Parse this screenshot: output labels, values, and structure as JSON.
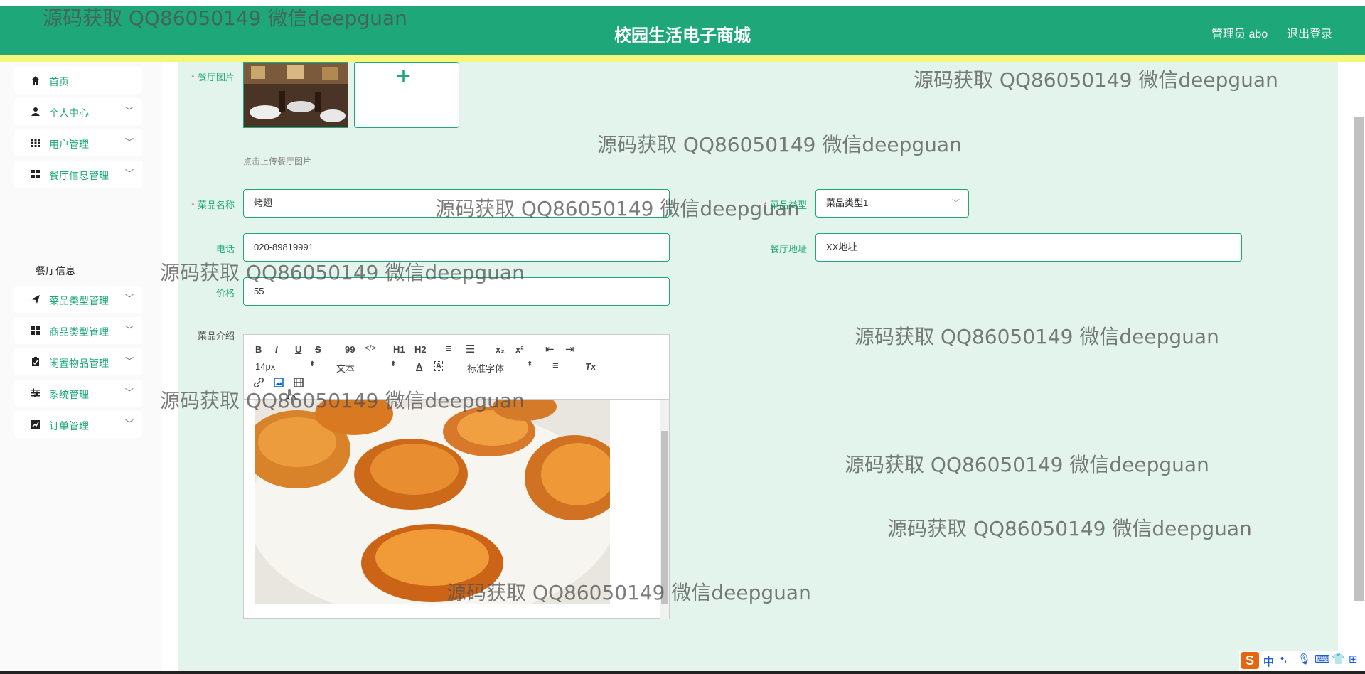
{
  "header": {
    "title": "校园生活电子商城",
    "user": "管理员 abo",
    "logout": "退出登录"
  },
  "sidebar": {
    "items": [
      {
        "label": "首页",
        "icon": "home-icon"
      },
      {
        "label": "个人中心",
        "icon": "user-icon"
      },
      {
        "label": "用户管理",
        "icon": "grid-icon"
      },
      {
        "label": "餐厅信息管理",
        "icon": "apps-icon"
      },
      {
        "label": "菜品类型管理",
        "icon": "send-icon"
      },
      {
        "label": "商品类型管理",
        "icon": "apps-icon"
      },
      {
        "label": "闲置物品管理",
        "icon": "clipboard-icon"
      },
      {
        "label": "系统管理",
        "icon": "sliders-icon"
      },
      {
        "label": "订单管理",
        "icon": "chart-icon"
      }
    ],
    "sub_item": "餐厅信息"
  },
  "form": {
    "image_label": "餐厅图片",
    "upload_hint": "点击上传餐厅图片",
    "upload_plus": "+",
    "dish_name_label": "菜品名称",
    "dish_name_value": "烤翅",
    "dish_type_label": "菜品类型",
    "dish_type_value": "菜品类型1",
    "phone_label": "电话",
    "phone_value": "020-89819991",
    "address_label": "餐厅地址",
    "address_value": "XX地址",
    "price_label": "价格",
    "price_value": "55",
    "intro_label": "菜品介绍"
  },
  "editor": {
    "font_size": "14px",
    "text_type": "文本",
    "font_family": "标准字体",
    "toolbar": [
      "B",
      "I",
      "U",
      "S",
      "99",
      "</>",
      "H1",
      "H2",
      "≡",
      "☰",
      "x₂",
      "x²",
      "⇤",
      "⇥",
      "A",
      "A",
      "≡",
      "Tx"
    ]
  },
  "watermark": "源码获取 QQ86050149 微信deepguan",
  "ime": {
    "label": "中"
  },
  "colors": {
    "primary": "#1ea879",
    "accent_bar": "#f6f77a",
    "main_bg": "#e3f4ec"
  }
}
